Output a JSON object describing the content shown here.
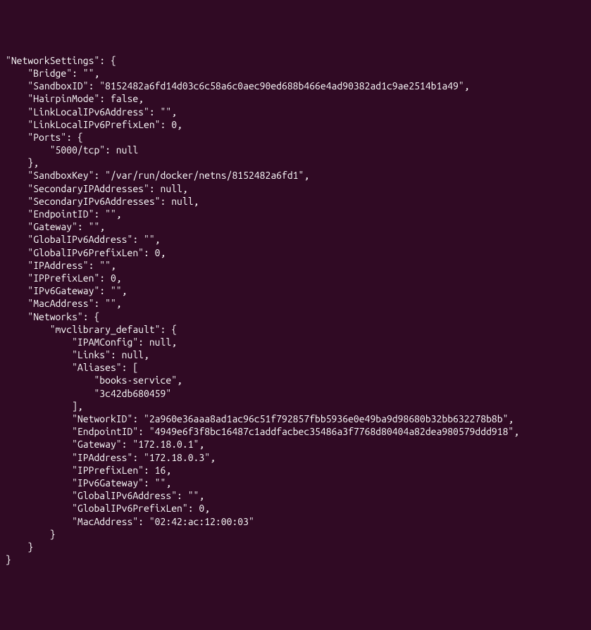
{
  "terminal": {
    "lines": [
      "\"NetworkSettings\": {",
      "    \"Bridge\": \"\",",
      "    \"SandboxID\": \"8152482a6fd14d03c6c58a6c0aec90ed688b466e4ad90382ad1c9ae2514b1a49\",",
      "    \"HairpinMode\": false,",
      "    \"LinkLocalIPv6Address\": \"\",",
      "    \"LinkLocalIPv6PrefixLen\": 0,",
      "    \"Ports\": {",
      "        \"5000/tcp\": null",
      "    },",
      "    \"SandboxKey\": \"/var/run/docker/netns/8152482a6fd1\",",
      "    \"SecondaryIPAddresses\": null,",
      "    \"SecondaryIPv6Addresses\": null,",
      "    \"EndpointID\": \"\",",
      "    \"Gateway\": \"\",",
      "    \"GlobalIPv6Address\": \"\",",
      "    \"GlobalIPv6PrefixLen\": 0,",
      "    \"IPAddress\": \"\",",
      "    \"IPPrefixLen\": 0,",
      "    \"IPv6Gateway\": \"\",",
      "    \"MacAddress\": \"\",",
      "    \"Networks\": {",
      "        \"mvclibrary_default\": {",
      "            \"IPAMConfig\": null,",
      "            \"Links\": null,",
      "            \"Aliases\": [",
      "                \"books-service\",",
      "                \"3c42db680459\"",
      "            ],",
      "            \"NetworkID\": \"2a960e36aaa8ad1ac96c51f792857fbb5936e0e49ba9d98680b32bb632278b8b\",",
      "            \"EndpointID\": \"4949e6f3f8bc16487c1addfacbec35486a3f7768d80404a82dea980579ddd918\",",
      "            \"Gateway\": \"172.18.0.1\",",
      "            \"IPAddress\": \"172.18.0.3\",",
      "            \"IPPrefixLen\": 16,",
      "            \"IPv6Gateway\": \"\",",
      "            \"GlobalIPv6Address\": \"\",",
      "            \"GlobalIPv6PrefixLen\": 0,",
      "            \"MacAddress\": \"02:42:ac:12:00:03\"",
      "        }",
      "    }",
      "}"
    ]
  }
}
